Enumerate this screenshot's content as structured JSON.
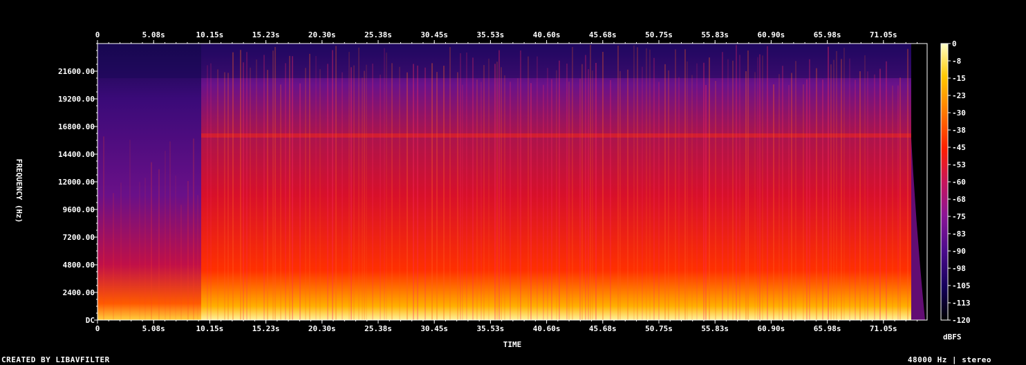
{
  "chart_data": {
    "type": "heatmap",
    "xlabel": "TIME",
    "ylabel": "FREQUENCY (Hz)",
    "x_ticks": [
      "0",
      "5.08s",
      "10.15s",
      "15.23s",
      "20.30s",
      "25.38s",
      "30.45s",
      "35.53s",
      "40.60s",
      "45.68s",
      "50.75s",
      "55.83s",
      "60.90s",
      "65.98s",
      "71.05s"
    ],
    "y_ticks": [
      "DC",
      "2400.00",
      "4800.00",
      "7200.00",
      "9600.00",
      "12000.00",
      "14400.00",
      "16800.00",
      "19200.00",
      "21600.00"
    ],
    "xlim": [
      0,
      75
    ],
    "ylim": [
      0,
      24000
    ],
    "colorbar": {
      "label": "dBFS",
      "ticks": [
        "0",
        "-8",
        "-15",
        "-23",
        "-30",
        "-38",
        "-45",
        "-53",
        "-60",
        "-68",
        "-75",
        "-83",
        "-90",
        "-98",
        "-105",
        "-113",
        "-120"
      ],
      "range": [
        -120,
        0
      ],
      "colors": [
        "#000000",
        "#14005a",
        "#4b0a8c",
        "#8c1496",
        "#c8145a",
        "#ff1e00",
        "#ff7800",
        "#ffc800",
        "#ffffc8"
      ]
    }
  },
  "footer": {
    "left": "CREATED BY LIBAVFILTER",
    "right": "48000 Hz | stereo"
  }
}
